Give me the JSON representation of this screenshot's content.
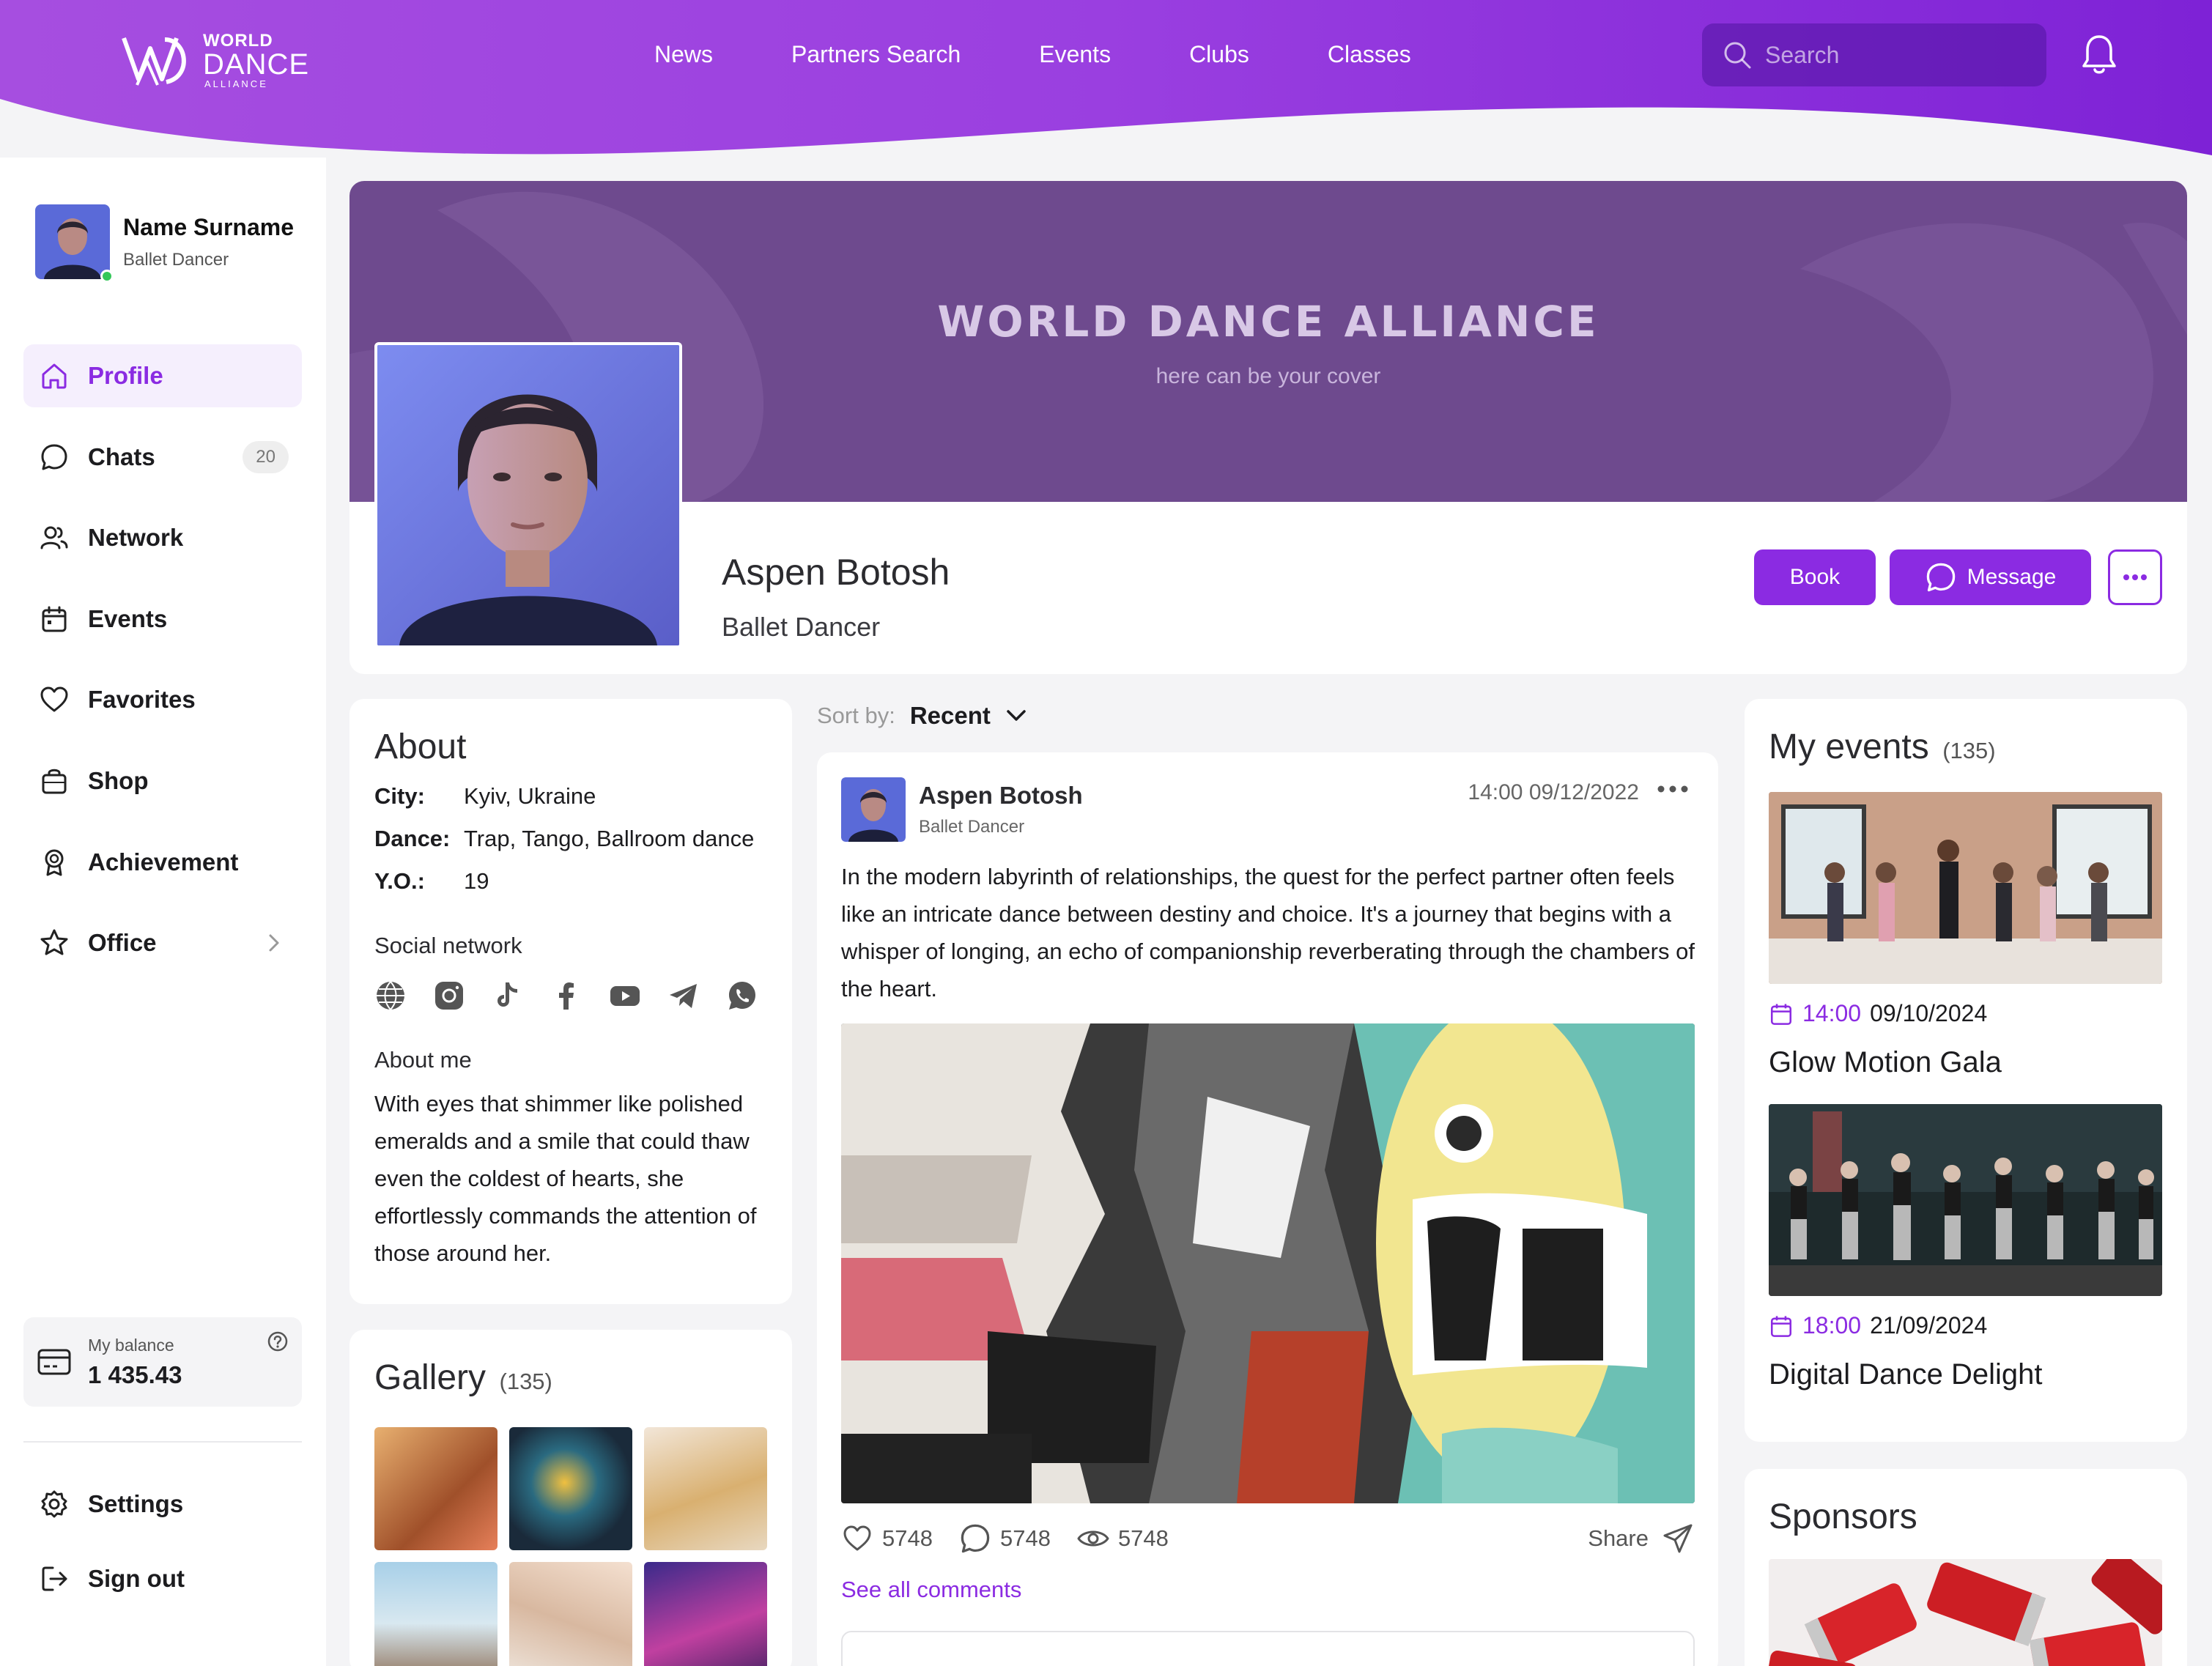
{
  "brand": {
    "logo_world": "WORLD",
    "logo_dance": "DANCE",
    "logo_alliance": "ALLIANCE",
    "accent": "#8b2be2"
  },
  "topnav": [
    "News",
    "Partners Search",
    "Events",
    "Clubs",
    "Classes"
  ],
  "search": {
    "placeholder": "Search",
    "icon": "search-icon"
  },
  "user": {
    "name": "Name Surname",
    "role": "Ballet Dancer",
    "online": true
  },
  "sidebar": {
    "items": [
      {
        "label": "Profile",
        "icon": "home-icon",
        "active": true
      },
      {
        "label": "Chats",
        "icon": "chat-icon",
        "badge": "20"
      },
      {
        "label": "Network",
        "icon": "users-icon"
      },
      {
        "label": "Events",
        "icon": "calendar-icon"
      },
      {
        "label": "Favorites",
        "icon": "heart-icon"
      },
      {
        "label": "Shop",
        "icon": "bag-icon"
      },
      {
        "label": "Achievement",
        "icon": "medal-icon"
      },
      {
        "label": "Office",
        "icon": "star-icon"
      }
    ],
    "balance": {
      "label": "My balance",
      "value": "1 435.43"
    },
    "bottom": [
      {
        "label": "Settings",
        "icon": "gear-icon"
      },
      {
        "label": "Sign out",
        "icon": "sign-out-icon"
      }
    ]
  },
  "profile": {
    "cover_title": "WORLD DANCE ALLIANCE",
    "cover_subtitle": "here can be your cover",
    "name": "Aspen Botosh",
    "role": "Ballet Dancer",
    "book_label": "Book",
    "message_label": "Message"
  },
  "about": {
    "title": "About",
    "fields": [
      {
        "key": "City:",
        "value": "Kyiv, Ukraine"
      },
      {
        "key": "Dance:",
        "value": "Trap, Tango, Ballroom dance"
      },
      {
        "key": "Y.O.:",
        "value": "19"
      }
    ],
    "social_title": "Social network",
    "social": [
      "globe-icon",
      "instagram-icon",
      "tiktok-icon",
      "facebook-icon",
      "youtube-icon",
      "telegram-icon",
      "whatsapp-icon"
    ],
    "about_me_title": "About me",
    "about_me_text": "With eyes that shimmer like polished emeralds and a smile that could thaw even the coldest of hearts, she effortlessly commands the attention of those around her."
  },
  "gallery": {
    "title": "Gallery",
    "count": "(135)"
  },
  "feed": {
    "sort_label": "Sort by:",
    "sort_value": "Recent",
    "post": {
      "author": "Aspen Botosh",
      "author_role": "Ballet Dancer",
      "time": "14:00",
      "date": "09/12/2022",
      "text": "In the modern labyrinth of relationships, the quest for the perfect partner often feels like an intricate dance between destiny and choice. It's a journey that begins with a whisper of longing, an echo of companionship reverberating through the chambers of the heart.",
      "likes": "5748",
      "comments": "5748",
      "views": "5748",
      "share_label": "Share",
      "see_comments": "See all comments"
    }
  },
  "events": {
    "title": "My events",
    "count": "(135)",
    "items": [
      {
        "time": "14:00",
        "date": "09/10/2024",
        "title": "Glow Motion Gala"
      },
      {
        "time": "18:00",
        "date": "21/09/2024",
        "title": "Digital Dance Delight"
      }
    ]
  },
  "sponsors": {
    "title": "Sponsors"
  }
}
